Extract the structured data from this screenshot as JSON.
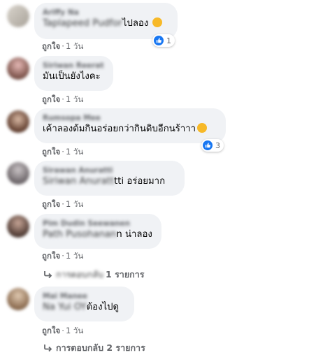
{
  "comments": [
    {
      "author": "Ariffy Na",
      "blurred_prefix": "Taplapeed Pudfor",
      "text": "ไปลอง",
      "like": "ถูกใจ",
      "time": "1 วัน",
      "reactions": "1"
    },
    {
      "author": "Siriwan Reerat",
      "text": "มันเป็นยังไงคะ",
      "like": "ถูกใจ",
      "time": "1 วัน"
    },
    {
      "author": "Rumsopa Mee",
      "text": "เค้าลองต้มกินอร่อยกว่ากินดิบอีกนร้าาา",
      "like": "ถูกใจ",
      "time": "1 วัน",
      "reactions": "3"
    },
    {
      "author": "Sirawan Anuratti",
      "blurred_prefix": "Siriwan Anuratt",
      "text": "tti อร่อยมาก",
      "like": "ถูกใจ",
      "time": "1 วัน"
    },
    {
      "author": "Pim Dudin Seewanen",
      "blurred_prefix": "Path Pusohanan",
      "text": "n น่าลอง",
      "like": "ถูกใจ",
      "time": "1 วัน"
    },
    {
      "author": "Mai Manee",
      "blurred_prefix": "Na Yui OY",
      "text": "ต้องไปดู",
      "like": "ถูกใจ",
      "time": "1 วัน"
    }
  ],
  "hidden_replies": {
    "blurred_prefix": "การตอบกลับ",
    "text": "1 รายการ"
  },
  "view_replies": "การตอบกลับ 2 รายการ",
  "separator": "·",
  "colors": {
    "like_blue": "#1877f2",
    "bubble": "#f0f2f5",
    "meta": "#65676b"
  }
}
